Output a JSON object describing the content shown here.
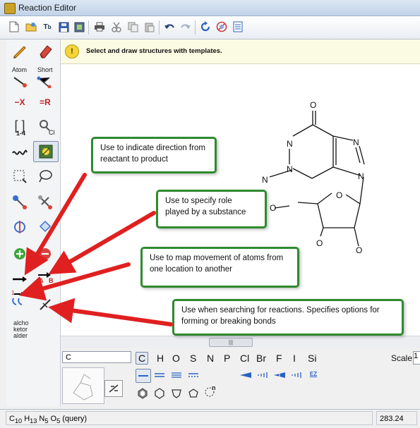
{
  "window": {
    "title": "Reaction Editor"
  },
  "toolbar": {
    "icons": [
      "new-document-icon",
      "open-folder-icon",
      "text-to-structure-icon",
      "save-icon",
      "save-image-icon",
      "print-icon",
      "cut-icon",
      "copy-icon",
      "paste-icon",
      "undo-icon",
      "redo-icon",
      "refresh-icon",
      "clear-icon",
      "properties-icon"
    ]
  },
  "hint": {
    "text": "Select and draw structures with templates."
  },
  "tools": {
    "atom_label": "Atom",
    "short_label": "Short",
    "delete_x": "−X",
    "replace_r": "=R",
    "bracket_label": "1-4",
    "cl_label": "Cl",
    "reaction_text": [
      "alcho",
      "ketor",
      "alder"
    ],
    "map_a": "A",
    "map_b": "B"
  },
  "molecule": {
    "atoms": {
      "O_top": "O",
      "N1": "N",
      "N3": "N",
      "N7": "N",
      "N9": "N",
      "NH": "N",
      "O_ring": "O",
      "O5": "O",
      "O2": "O",
      "O3": "O"
    }
  },
  "callouts": {
    "direction": "Use to indicate direction from reactant to product",
    "role": "Use to specify role played by a substance",
    "map": "Use to map movement of atoms from one location to another",
    "search": "Use when searching for reactions. Specifies options for forming or breaking bonds"
  },
  "bottom": {
    "atom_input_value": "C",
    "elements": [
      "C",
      "H",
      "O",
      "S",
      "N",
      "P",
      "Cl",
      "Br",
      "F",
      "I",
      "Si"
    ],
    "scale_label": "Scale",
    "scale_value": "1",
    "ez_label": "EZ",
    "template_n_label": "n"
  },
  "status": {
    "formula_parts": [
      "C",
      "10",
      "H",
      "13",
      "N",
      "5",
      "O",
      "5"
    ],
    "formula_suffix": "(query)",
    "value": "283.24"
  },
  "colors": {
    "callout_border": "#2f8a2f",
    "arrow": "#e02020",
    "hint_bg": "#fbfbe3"
  }
}
